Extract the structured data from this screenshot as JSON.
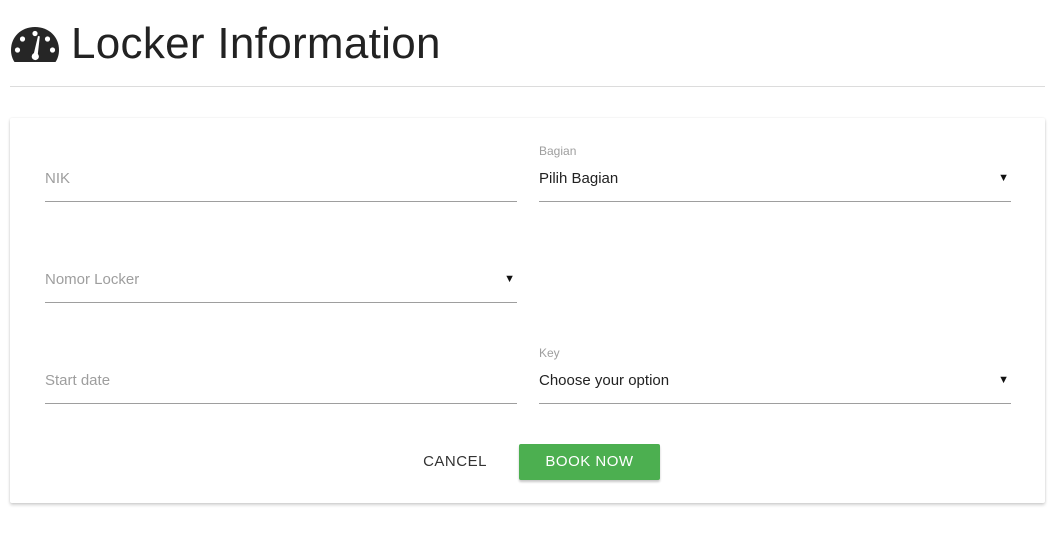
{
  "header": {
    "icon": "dashboard-gauge-icon",
    "title": "Locker Information"
  },
  "form": {
    "nik": {
      "placeholder": "NIK"
    },
    "bagian": {
      "label": "Bagian",
      "value": "Pilih Bagian",
      "caret": "▼"
    },
    "nomor_locker": {
      "placeholder": "Nomor Locker",
      "caret": "▼"
    },
    "start_date": {
      "placeholder": "Start date"
    },
    "key": {
      "label": "Key",
      "value": "Choose your option",
      "caret": "▼"
    }
  },
  "actions": {
    "cancel_label": "CANCEL",
    "book_label": "BOOK NOW"
  },
  "colors": {
    "accent": "#4caf50",
    "divider": "#dcdcdc",
    "input_line": "#9e9e9e",
    "placeholder": "#9e9e9e"
  }
}
